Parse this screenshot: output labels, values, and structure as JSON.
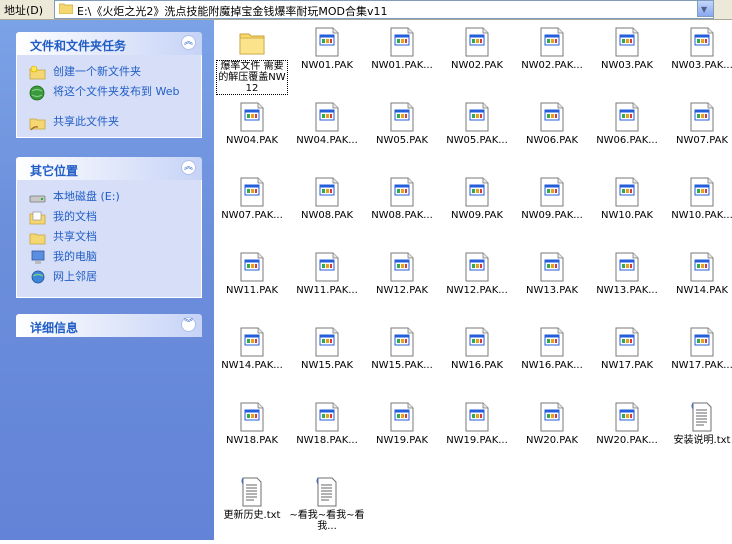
{
  "address": {
    "label": "地址(D)",
    "path": "E:\\《火炬之光2》洗点技能附魔掉宝金钱爆率耐玩MOD合集v11"
  },
  "panels": {
    "tasks": {
      "title": "文件和文件夹任务",
      "items": [
        {
          "label": "创建一个新文件夹",
          "icon": "new-folder-icon"
        },
        {
          "label": "将这个文件夹发布到 Web",
          "icon": "publish-web-icon"
        },
        {
          "label": "共享此文件夹",
          "icon": "share-folder-icon"
        }
      ]
    },
    "places": {
      "title": "其它位置",
      "items": [
        {
          "label": "本地磁盘 (E:)",
          "icon": "local-disk-icon"
        },
        {
          "label": "我的文档",
          "icon": "my-documents-icon"
        },
        {
          "label": "共享文档",
          "icon": "shared-documents-icon"
        },
        {
          "label": "我的电脑",
          "icon": "my-computer-icon"
        },
        {
          "label": "网上邻居",
          "icon": "network-places-icon"
        }
      ]
    },
    "details": {
      "title": "详细信息"
    }
  },
  "files": [
    {
      "name": "爆率文件 需要的解压覆盖NW12",
      "type": "folder"
    },
    {
      "name": "NW01.PAK",
      "type": "pak"
    },
    {
      "name": "NW01.PAK...",
      "type": "pak"
    },
    {
      "name": "NW02.PAK",
      "type": "pak"
    },
    {
      "name": "NW02.PAK...",
      "type": "pak"
    },
    {
      "name": "NW03.PAK",
      "type": "pak"
    },
    {
      "name": "NW03.PAK...",
      "type": "pak"
    },
    {
      "name": "NW04.PAK",
      "type": "pak"
    },
    {
      "name": "NW04.PAK...",
      "type": "pak"
    },
    {
      "name": "NW05.PAK",
      "type": "pak"
    },
    {
      "name": "NW05.PAK...",
      "type": "pak"
    },
    {
      "name": "NW06.PAK",
      "type": "pak"
    },
    {
      "name": "NW06.PAK...",
      "type": "pak"
    },
    {
      "name": "NW07.PAK",
      "type": "pak"
    },
    {
      "name": "NW07.PAK...",
      "type": "pak"
    },
    {
      "name": "NW08.PAK",
      "type": "pak"
    },
    {
      "name": "NW08.PAK...",
      "type": "pak"
    },
    {
      "name": "NW09.PAK",
      "type": "pak"
    },
    {
      "name": "NW09.PAK...",
      "type": "pak"
    },
    {
      "name": "NW10.PAK",
      "type": "pak"
    },
    {
      "name": "NW10.PAK...",
      "type": "pak"
    },
    {
      "name": "NW11.PAK",
      "type": "pak"
    },
    {
      "name": "NW11.PAK...",
      "type": "pak"
    },
    {
      "name": "NW12.PAK",
      "type": "pak"
    },
    {
      "name": "NW12.PAK...",
      "type": "pak"
    },
    {
      "name": "NW13.PAK",
      "type": "pak"
    },
    {
      "name": "NW13.PAK...",
      "type": "pak"
    },
    {
      "name": "NW14.PAK",
      "type": "pak"
    },
    {
      "name": "NW14.PAK...",
      "type": "pak"
    },
    {
      "name": "NW15.PAK",
      "type": "pak"
    },
    {
      "name": "NW15.PAK...",
      "type": "pak"
    },
    {
      "name": "NW16.PAK",
      "type": "pak"
    },
    {
      "name": "NW16.PAK...",
      "type": "pak"
    },
    {
      "name": "NW17.PAK",
      "type": "pak"
    },
    {
      "name": "NW17.PAK...",
      "type": "pak"
    },
    {
      "name": "NW18.PAK",
      "type": "pak"
    },
    {
      "name": "NW18.PAK...",
      "type": "pak"
    },
    {
      "name": "NW19.PAK",
      "type": "pak"
    },
    {
      "name": "NW19.PAK...",
      "type": "pak"
    },
    {
      "name": "NW20.PAK",
      "type": "pak"
    },
    {
      "name": "NW20.PAK...",
      "type": "pak"
    },
    {
      "name": "安装说明.txt",
      "type": "txt"
    },
    {
      "name": "更新历史.txt",
      "type": "txt"
    },
    {
      "name": "~看我~看我~看我...",
      "type": "txt"
    }
  ]
}
